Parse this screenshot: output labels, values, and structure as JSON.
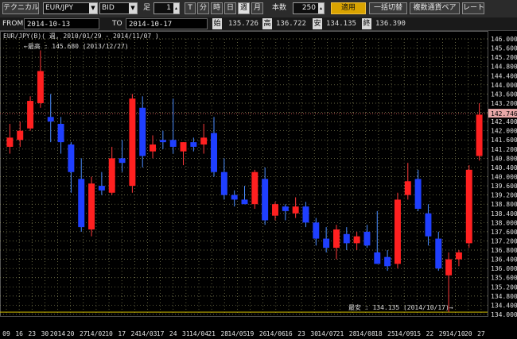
{
  "toolbar": {
    "technical_label": "テクニカル",
    "pair": "EUR/JPY",
    "price_type": "BID",
    "foot_label": "足",
    "foot_value": "1",
    "tf_tick": "T",
    "tf_minute": "分",
    "tf_hour": "時",
    "tf_day": "日",
    "tf_week": "週",
    "tf_month": "月",
    "bars_label": "本数",
    "bars_value": "250",
    "apply_label": "適用",
    "bulk_switch_label": "一括切替",
    "multi_pair_label": "複数通貨ペア",
    "rate_label": "レート"
  },
  "info": {
    "from_label": "FROM",
    "from_date": "2014-10-13",
    "to_label": "TO",
    "to_date": "2014-10-17",
    "open_label": "始",
    "open_value": "135.726",
    "high_label": "高",
    "high_value": "136.722",
    "low_label": "安",
    "low_value": "134.135",
    "close_label": "終",
    "close_value": "136.390"
  },
  "chart": {
    "header": "EUR/JPY(B)( 週, 2010/01/29 - 2014/11/07 )",
    "high_annotation": "←最高 : 145.680 (2013/12/27)",
    "low_annotation": "最安 : 134.135 (2014/10/17)→",
    "current_price_label": "142.746",
    "colors": {
      "bull": "#ff2020",
      "bear": "#1f3fff",
      "wick": "#ff3a3a",
      "grid": "#8a8a5a",
      "current_line": "#c05050",
      "low_line": "#d8c400",
      "label_bg": "#e8a8a8"
    }
  },
  "chart_data": {
    "type": "candlestick",
    "title": "EUR/JPY(B)( 週, 2010/01/29 - 2014/11/07 )",
    "ylim": [
      134.0,
      146.0
    ],
    "y_ticks": [
      "146.000",
      "145.600",
      "145.200",
      "144.800",
      "144.400",
      "144.000",
      "143.600",
      "143.200",
      "142.800",
      "142.400",
      "142.000",
      "141.600",
      "141.200",
      "140.800",
      "140.400",
      "140.000",
      "139.600",
      "139.200",
      "138.800",
      "138.400",
      "138.000",
      "137.600",
      "137.200",
      "136.800",
      "136.400",
      "136.000",
      "135.600",
      "135.200",
      "134.800",
      "134.400",
      "134.000"
    ],
    "x_ticks": [
      "09",
      "16",
      "23",
      "30",
      "2014",
      "20",
      "27",
      "14/02",
      "10",
      "17",
      "24",
      "14/03",
      "17",
      "24",
      "31",
      "14/04",
      "21",
      "28",
      "14/05",
      "19",
      "26",
      "14/06",
      "16",
      "23",
      "30",
      "14/07",
      "21",
      "28",
      "14/08",
      "18",
      "25",
      "14/09",
      "15",
      "22",
      "29",
      "14/10",
      "20",
      "27"
    ],
    "current_price": 142.746,
    "candles": [
      {
        "o": 141.3,
        "h": 142.3,
        "l": 141.0,
        "c": 141.7
      },
      {
        "o": 141.6,
        "h": 142.4,
        "l": 141.3,
        "c": 142.0
      },
      {
        "o": 142.1,
        "h": 143.5,
        "l": 142.0,
        "c": 143.3
      },
      {
        "o": 143.2,
        "h": 145.5,
        "l": 143.0,
        "c": 144.6
      },
      {
        "o": 142.6,
        "h": 143.6,
        "l": 141.5,
        "c": 142.4
      },
      {
        "o": 142.3,
        "h": 142.6,
        "l": 141.0,
        "c": 141.5
      },
      {
        "o": 141.4,
        "h": 141.5,
        "l": 139.3,
        "c": 140.2
      },
      {
        "o": 139.9,
        "h": 140.8,
        "l": 137.6,
        "c": 137.8
      },
      {
        "o": 137.7,
        "h": 140.0,
        "l": 137.4,
        "c": 139.7
      },
      {
        "o": 139.6,
        "h": 140.2,
        "l": 139.2,
        "c": 139.4
      },
      {
        "o": 139.3,
        "h": 141.3,
        "l": 139.2,
        "c": 140.8
      },
      {
        "o": 140.8,
        "h": 141.6,
        "l": 140.2,
        "c": 140.6
      },
      {
        "o": 139.6,
        "h": 143.6,
        "l": 139.3,
        "c": 143.4
      },
      {
        "o": 143.0,
        "h": 143.5,
        "l": 140.4,
        "c": 140.9
      },
      {
        "o": 141.1,
        "h": 141.8,
        "l": 140.8,
        "c": 141.4
      },
      {
        "o": 141.6,
        "h": 142.0,
        "l": 141.2,
        "c": 141.5
      },
      {
        "o": 141.6,
        "h": 143.4,
        "l": 141.0,
        "c": 141.3
      },
      {
        "o": 141.1,
        "h": 141.5,
        "l": 140.5,
        "c": 141.5
      },
      {
        "o": 141.5,
        "h": 141.7,
        "l": 141.1,
        "c": 141.3
      },
      {
        "o": 141.4,
        "h": 142.3,
        "l": 141.0,
        "c": 141.7
      },
      {
        "o": 141.9,
        "h": 142.6,
        "l": 140.0,
        "c": 140.2
      },
      {
        "o": 140.2,
        "h": 140.8,
        "l": 139.0,
        "c": 139.2
      },
      {
        "o": 139.2,
        "h": 139.4,
        "l": 138.7,
        "c": 139.0
      },
      {
        "o": 139.0,
        "h": 139.6,
        "l": 138.8,
        "c": 138.8
      },
      {
        "o": 138.8,
        "h": 140.3,
        "l": 138.6,
        "c": 140.2
      },
      {
        "o": 139.9,
        "h": 140.4,
        "l": 137.9,
        "c": 138.1
      },
      {
        "o": 138.3,
        "h": 138.9,
        "l": 138.1,
        "c": 138.8
      },
      {
        "o": 138.7,
        "h": 138.8,
        "l": 138.1,
        "c": 138.5
      },
      {
        "o": 138.4,
        "h": 139.1,
        "l": 138.2,
        "c": 138.7
      },
      {
        "o": 138.7,
        "h": 138.9,
        "l": 137.8,
        "c": 138.0
      },
      {
        "o": 138.0,
        "h": 138.2,
        "l": 137.0,
        "c": 137.3
      },
      {
        "o": 137.3,
        "h": 137.8,
        "l": 136.7,
        "c": 136.9
      },
      {
        "o": 136.9,
        "h": 137.9,
        "l": 136.4,
        "c": 137.7
      },
      {
        "o": 137.5,
        "h": 137.8,
        "l": 136.8,
        "c": 137.1
      },
      {
        "o": 137.1,
        "h": 137.6,
        "l": 136.8,
        "c": 137.4
      },
      {
        "o": 137.6,
        "h": 137.9,
        "l": 136.9,
        "c": 137.0
      },
      {
        "o": 136.7,
        "h": 138.5,
        "l": 136.2,
        "c": 136.2
      },
      {
        "o": 136.5,
        "h": 136.8,
        "l": 135.9,
        "c": 136.1
      },
      {
        "o": 136.2,
        "h": 139.3,
        "l": 136.0,
        "c": 139.0
      },
      {
        "o": 139.2,
        "h": 140.6,
        "l": 139.0,
        "c": 139.8
      },
      {
        "o": 139.9,
        "h": 140.3,
        "l": 138.5,
        "c": 138.6
      },
      {
        "o": 138.4,
        "h": 138.8,
        "l": 137.0,
        "c": 137.4
      },
      {
        "o": 137.3,
        "h": 137.6,
        "l": 135.9,
        "c": 136.0
      },
      {
        "o": 135.7,
        "h": 136.7,
        "l": 134.1,
        "c": 136.4
      },
      {
        "o": 136.4,
        "h": 136.8,
        "l": 136.1,
        "c": 136.7
      },
      {
        "o": 137.1,
        "h": 140.5,
        "l": 136.9,
        "c": 140.3
      },
      {
        "o": 140.9,
        "h": 143.2,
        "l": 140.7,
        "c": 142.7
      }
    ]
  }
}
